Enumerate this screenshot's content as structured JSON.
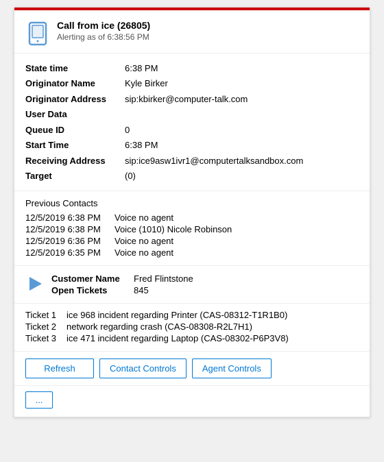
{
  "card": {
    "header": {
      "title": "Call from ice (26805)",
      "subtitle": "Alerting as of 6:38:56 PM"
    },
    "info": {
      "state_time_label": "State time",
      "state_time_value": "6:38 PM",
      "originator_name_label": "Originator Name",
      "originator_name_value": "Kyle Birker",
      "originator_address_label": "Originator Address",
      "originator_address_value": "sip:kbirker@computer-talk.com",
      "user_data_label": "User Data",
      "user_data_value": "",
      "queue_id_label": "Queue ID",
      "queue_id_value": "0",
      "start_time_label": "Start Time",
      "start_time_value": "6:38 PM",
      "receiving_address_label": "Receiving Address",
      "receiving_address_value": "sip:ice9asw1ivr1@computertalksandbox.com",
      "target_label": "Target",
      "target_value": "(0)"
    },
    "previous_contacts": {
      "heading": "Previous Contacts",
      "items": [
        {
          "date": "12/5/2019 6:38 PM",
          "description": "Voice no agent"
        },
        {
          "date": "12/5/2019 6:38 PM",
          "description": "Voice (1010) Nicole Robinson"
        },
        {
          "date": "12/5/2019 6:36 PM",
          "description": "Voice no agent"
        },
        {
          "date": "12/5/2019 6:35 PM",
          "description": "Voice no agent"
        }
      ]
    },
    "crm": {
      "customer_name_label": "Customer Name",
      "customer_name_value": "Fred Flintstone",
      "open_tickets_label": "Open Tickets",
      "open_tickets_value": "845"
    },
    "tickets": [
      {
        "label": "Ticket 1",
        "description": "ice 968 incident regarding Printer (CAS-08312-T1R1B0)"
      },
      {
        "label": "Ticket 2",
        "description": "network regarding crash (CAS-08308-R2L7H1)"
      },
      {
        "label": "Ticket 3",
        "description": "ice 471 incident regarding Laptop (CAS-08302-P6P3V8)"
      }
    ],
    "buttons": {
      "refresh": "Refresh",
      "contact_controls": "Contact Controls",
      "agent_controls": "Agent Controls",
      "more": "..."
    }
  }
}
